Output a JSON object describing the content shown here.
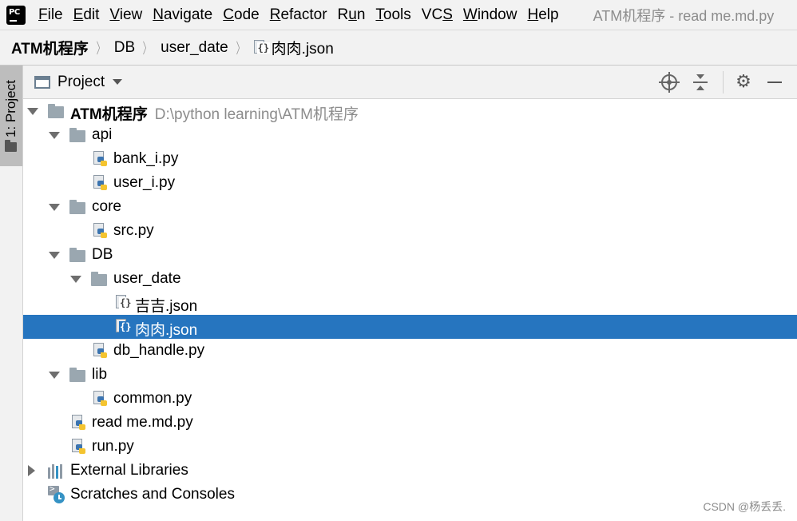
{
  "menubar": {
    "logo_text": "PC",
    "items": [
      {
        "mnemonic": "F",
        "rest": "ile"
      },
      {
        "mnemonic": "E",
        "rest": "dit"
      },
      {
        "mnemonic": "V",
        "rest": "iew"
      },
      {
        "mnemonic": "N",
        "rest": "avigate"
      },
      {
        "mnemonic": "C",
        "rest": "ode"
      },
      {
        "mnemonic": "R",
        "rest": "efactor"
      },
      {
        "pre": "R",
        "mnemonic": "u",
        "rest": "n"
      },
      {
        "mnemonic": "T",
        "rest": "ools"
      },
      {
        "pre": "VC",
        "mnemonic": "S",
        "rest": ""
      },
      {
        "mnemonic": "W",
        "rest": "indow"
      },
      {
        "mnemonic": "H",
        "rest": "elp"
      }
    ],
    "window_title": "ATM机程序 - read me.md.py"
  },
  "breadcrumb": {
    "items": [
      "ATM机程序",
      "DB",
      "user_date",
      "肉肉.json"
    ]
  },
  "toolstrip": {
    "project_tab_label": "1: Project"
  },
  "project_panel": {
    "title": "Project"
  },
  "tree": {
    "root_name": "ATM机程序",
    "root_path": "D:\\python learning\\ATM机程序",
    "api": "api",
    "bank_i": "bank_i.py",
    "user_i": "user_i.py",
    "core": "core",
    "src": "src.py",
    "db": "DB",
    "user_date": "user_date",
    "jiji_json": "吉吉.json",
    "rourou_json": "肉肉.json",
    "db_handle": "db_handle.py",
    "lib": "lib",
    "common": "common.py",
    "readme": "read me.md.py",
    "run": "run.py",
    "external_libraries": "External Libraries",
    "scratches": "Scratches and Consoles"
  },
  "icons": {
    "folder_color": "#9aa7b0",
    "selection_color": "#2675bf",
    "json_glyph": "{}"
  },
  "watermark": "CSDN @杨丢丢."
}
